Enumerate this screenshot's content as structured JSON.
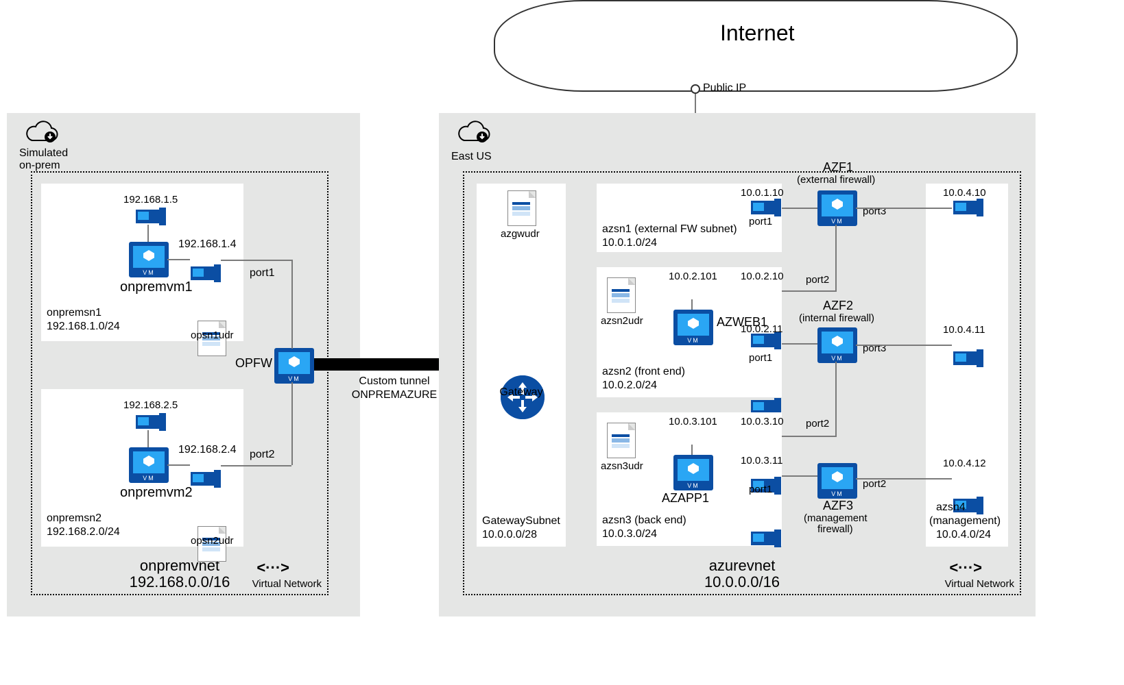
{
  "internet": {
    "label": "Internet",
    "public_ip": "Public IP"
  },
  "tunnel": {
    "label1": "Custom tunnel",
    "label2": "ONPREMAZURE"
  },
  "gateway": {
    "label": "Gateway"
  },
  "left": {
    "rg_label1": "Simulated",
    "rg_label2": "on-prem",
    "vnet_name": "onpremvnet",
    "vnet_cidr": "192.168.0.0/16",
    "vnet_tag": "Virtual Network",
    "opfw": {
      "label": "OPFW",
      "port1": "port1",
      "port2": "port2"
    },
    "sn1": {
      "name": "onpremsn1",
      "cidr": "192.168.1.0/24",
      "vm": "onpremvm1",
      "ip_nic1": "192.168.1.5",
      "ip_nic2": "192.168.1.4",
      "udr": "opsn1udr"
    },
    "sn2": {
      "name": "onpremsn2",
      "cidr": "192.168.2.0/24",
      "vm": "onpremvm2",
      "ip_nic1": "192.168.2.5",
      "ip_nic2": "192.168.2.4",
      "udr": "opsn2udr"
    }
  },
  "right": {
    "rg_label": "East US",
    "vnet_name": "azurevnet",
    "vnet_cidr": "10.0.0.0/16",
    "vnet_tag": "Virtual Network",
    "gwsubnet": {
      "udr": "azgwudr",
      "name": "GatewaySubnet",
      "cidr": "10.0.0.0/28"
    },
    "sn1": {
      "title": "azsn1 (external FW subnet)",
      "cidr": "10.0.1.0/24",
      "ip": "10.0.1.10",
      "port": "port1"
    },
    "sn2": {
      "udr": "azsn2udr",
      "title": "azsn2 (front end)",
      "cidr": "10.0.2.0/24",
      "vm": "AZWEB1",
      "ip_nic1": "10.0.2.101",
      "ip_fw1": "10.0.2.10",
      "ip_fw2": "10.0.2.11",
      "port": "port1"
    },
    "sn3": {
      "udr": "azsn3udr",
      "title": "azsn3 (back end)",
      "cidr": "10.0.3.0/24",
      "vm": "AZAPP1",
      "ip_nic1": "10.0.3.101",
      "ip_fw1": "10.0.3.10",
      "ip_fw2": "10.0.3.11",
      "port": "port1"
    },
    "sn4": {
      "title": "azsn4",
      "sub": "(management)",
      "cidr": "10.0.4.0/24",
      "ip1": "10.0.4.10",
      "ip2": "10.0.4.11",
      "ip3": "10.0.4.12"
    },
    "azf1": {
      "name": "AZF1",
      "sub": "(external firewall)",
      "port2": "port2",
      "port3": "port3"
    },
    "azf2": {
      "name": "AZF2",
      "sub": "(internal firewall)",
      "port2": "port2",
      "port3": "port3"
    },
    "azf3": {
      "name": "AZF3",
      "sub": "(management",
      "sub2": "firewall)",
      "port2": "port2"
    }
  }
}
